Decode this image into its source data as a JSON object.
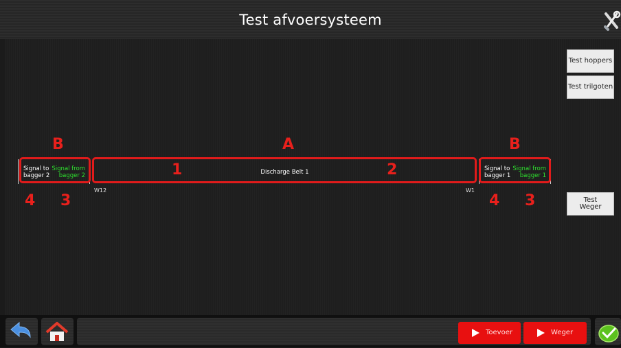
{
  "header": {
    "title": "Test afvoersysteem",
    "tools_icon": "wrench-screwdriver-icon"
  },
  "side_buttons": {
    "test_hoppers": "Test hoppers",
    "test_trilgoten": "Test trilgoten",
    "test_weger_line1": "Test",
    "test_weger_line2": "Weger"
  },
  "left_signals": {
    "to_line1": "Signal to",
    "to_line2": "bagger 2",
    "from_line1": "Signal from",
    "from_line2": "bagger 2"
  },
  "right_signals": {
    "to_line1": "Signal to",
    "to_line2": "bagger 1",
    "from_line1": "Signal from",
    "from_line2": "bagger 1"
  },
  "belt": {
    "label": "Discharge Belt 1",
    "left_weigher": "W12",
    "right_weigher": "W1"
  },
  "annotations": {
    "a": "A",
    "b_left": "B",
    "b_right": "B",
    "one": "1",
    "two": "2",
    "four_left": "4",
    "three_left": "3",
    "four_right": "4",
    "three_right": "3"
  },
  "footer": {
    "back_icon": "back-arrow-icon",
    "home_icon": "home-icon",
    "toevoer_label": "Toevoer",
    "weger_label": "Weger",
    "confirm_icon": "checkmark-icon"
  },
  "colors": {
    "signal_from": "#2ee02e",
    "annotation": "#e8201c",
    "action_button": "#e81010"
  }
}
